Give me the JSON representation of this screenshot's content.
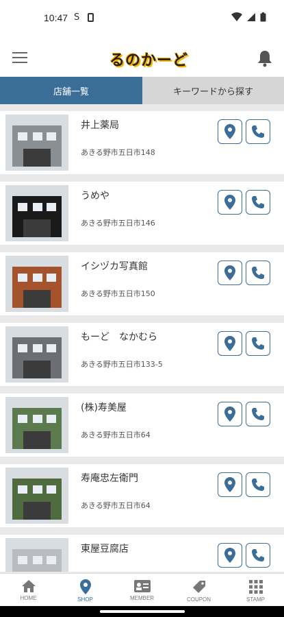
{
  "status_bar": {
    "time": "10:47",
    "icons": [
      "s-app-icon",
      "sim-icon",
      "wifi-icon",
      "signal-icon",
      "battery-icon"
    ]
  },
  "header": {
    "logo_text": "るのかーど",
    "menu_icon": "hamburger-icon",
    "bell_icon": "bell-icon"
  },
  "tabs": [
    {
      "label": "店舗一覧",
      "active": true
    },
    {
      "label": "キーワードから探す",
      "active": false
    }
  ],
  "shops": [
    {
      "name": "井上薬局",
      "address": "あきる野市五日市148",
      "thumb_color": "#8a8f93"
    },
    {
      "name": "うめや",
      "address": "あきる野市五日市146",
      "thumb_color": "#1a1a1a"
    },
    {
      "name": "イシヅカ写真館",
      "address": "あきる野市五日市150",
      "thumb_color": "#a5532d"
    },
    {
      "name": "もーど　なかむら",
      "address": "あきる野市五日市133-5",
      "thumb_color": "#6b6f74"
    },
    {
      "name": "(株)寿美屋",
      "address": "あきる野市五日市64",
      "thumb_color": "#5b7a4e"
    },
    {
      "name": "寿庵忠左衛門",
      "address": "あきる野市五日市64",
      "thumb_color": "#4f6b3f"
    },
    {
      "name": "東屋豆腐店",
      "address": "",
      "thumb_color": "#b9bcc1"
    }
  ],
  "bottom_nav": [
    {
      "label": "HOME",
      "icon": "home-icon",
      "active": false
    },
    {
      "label": "SHOP",
      "icon": "map-pin-icon",
      "active": true
    },
    {
      "label": "MEMBER",
      "icon": "member-card-icon",
      "active": false
    },
    {
      "label": "COUPON",
      "icon": "coupon-icon",
      "active": false
    },
    {
      "label": "STAMP",
      "icon": "stamp-grid-icon",
      "active": false
    }
  ],
  "colors": {
    "accent": "#3a6d97",
    "tab_inactive": "#d6d6d6",
    "background": "#e9e9e9"
  }
}
